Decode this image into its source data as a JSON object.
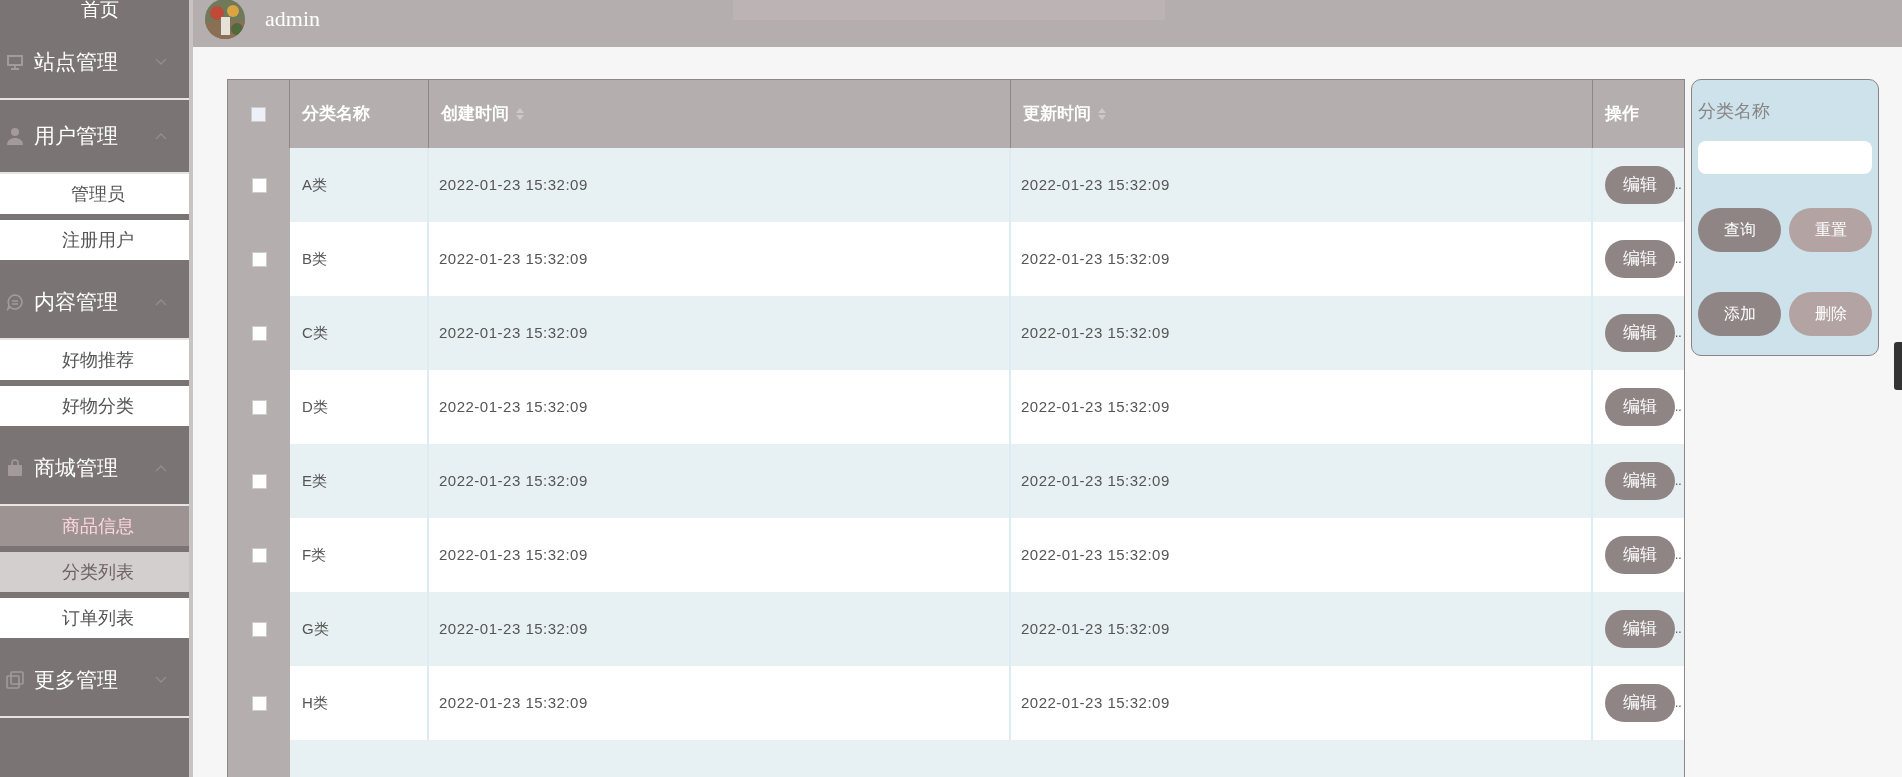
{
  "sidebar": {
    "items": [
      {
        "label": "首页",
        "kind": "link"
      },
      {
        "label": "站点管理",
        "kind": "group",
        "expanded": false
      },
      {
        "label": "用户管理",
        "kind": "group",
        "expanded": true,
        "children": [
          {
            "label": "管理员",
            "selected": false,
            "highlighted": false
          },
          {
            "label": "注册用户",
            "selected": false,
            "highlighted": false
          }
        ]
      },
      {
        "label": "内容管理",
        "kind": "group",
        "expanded": true,
        "children": [
          {
            "label": "好物推荐",
            "selected": false,
            "highlighted": false
          },
          {
            "label": "好物分类",
            "selected": false,
            "highlighted": false
          }
        ]
      },
      {
        "label": "商城管理",
        "kind": "group",
        "expanded": true,
        "children": [
          {
            "label": "商品信息",
            "selected": true,
            "highlighted": false
          },
          {
            "label": "分类列表",
            "selected": false,
            "highlighted": true
          },
          {
            "label": "订单列表",
            "selected": false,
            "highlighted": false
          }
        ]
      },
      {
        "label": "更多管理",
        "kind": "group",
        "expanded": false
      }
    ]
  },
  "header": {
    "username": "admin"
  },
  "table": {
    "columns": [
      {
        "label": "分类名称",
        "sortable": false
      },
      {
        "label": "创建时间",
        "sortable": true
      },
      {
        "label": "更新时间",
        "sortable": true
      },
      {
        "label": "操作",
        "sortable": false
      }
    ],
    "header_checked": false,
    "rows": [
      {
        "name": "A类",
        "created": "2022-01-23 15:32:09",
        "updated": "2022-01-23 15:32:09",
        "action": "编辑",
        "more": "..",
        "checked": false
      },
      {
        "name": "B类",
        "created": "2022-01-23 15:32:09",
        "updated": "2022-01-23 15:32:09",
        "action": "编辑",
        "more": "..",
        "checked": false
      },
      {
        "name": "C类",
        "created": "2022-01-23 15:32:09",
        "updated": "2022-01-23 15:32:09",
        "action": "编辑",
        "more": "..",
        "checked": false
      },
      {
        "name": "D类",
        "created": "2022-01-23 15:32:09",
        "updated": "2022-01-23 15:32:09",
        "action": "编辑",
        "more": "..",
        "checked": false
      },
      {
        "name": "E类",
        "created": "2022-01-23 15:32:09",
        "updated": "2022-01-23 15:32:09",
        "action": "编辑",
        "more": "..",
        "checked": false
      },
      {
        "name": "F类",
        "created": "2022-01-23 15:32:09",
        "updated": "2022-01-23 15:32:09",
        "action": "编辑",
        "more": "..",
        "checked": false
      },
      {
        "name": "G类",
        "created": "2022-01-23 15:32:09",
        "updated": "2022-01-23 15:32:09",
        "action": "编辑",
        "more": "..",
        "checked": false
      },
      {
        "name": "H类",
        "created": "2022-01-23 15:32:09",
        "updated": "2022-01-23 15:32:09",
        "action": "编辑",
        "more": "..",
        "checked": false
      }
    ]
  },
  "search_panel": {
    "label": "分类名称",
    "buttons": [
      {
        "label": "查询",
        "kind": "primary"
      },
      {
        "label": "重置",
        "kind": "secondary"
      },
      {
        "label": "添加",
        "kind": "primary"
      },
      {
        "label": "删除",
        "kind": "secondary"
      }
    ]
  }
}
